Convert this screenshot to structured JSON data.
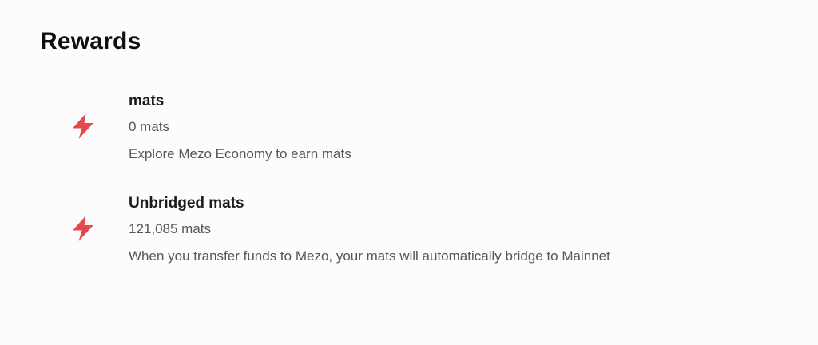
{
  "page": {
    "title": "Rewards"
  },
  "theme": {
    "accent": "#e5484d",
    "text_primary": "#1b1b1f",
    "text_secondary": "#56565c",
    "background": "#fcfcfc"
  },
  "rewards": [
    {
      "icon": "lightning-bolt-icon",
      "title": "mats",
      "amount": "0 mats",
      "description": "Explore Mezo Economy to earn mats"
    },
    {
      "icon": "lightning-bolt-icon",
      "title": "Unbridged mats",
      "amount": "121,085 mats",
      "description": "When you transfer funds to Mezo, your mats will automatically bridge to Mainnet"
    }
  ]
}
